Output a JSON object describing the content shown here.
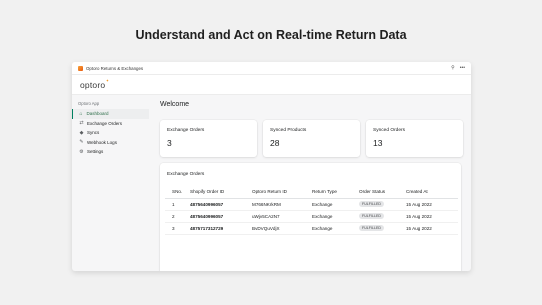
{
  "headline": "Understand and Act on Real-time Return Data",
  "window": {
    "title": "Optoro Returns & Exchanges",
    "pin_icon": "pin-icon",
    "more_icon": "more-icon"
  },
  "brand": {
    "logo_text": "optoro"
  },
  "sidebar": {
    "section_label": "Optoro App",
    "items": [
      {
        "label": "Dashboard",
        "icon": "home-icon",
        "active": true
      },
      {
        "label": "Exchange Orders",
        "icon": "exchange-icon"
      },
      {
        "label": "Syncs",
        "icon": "tag-icon"
      },
      {
        "label": "Webhook Logs",
        "icon": "wrench-icon"
      },
      {
        "label": "Settings",
        "icon": "gear-icon"
      }
    ]
  },
  "main": {
    "welcome": "Welcome",
    "stats": [
      {
        "label": "Exchange Orders",
        "value": "3"
      },
      {
        "label": "Synced Products",
        "value": "28"
      },
      {
        "label": "Synced Orders",
        "value": "13"
      }
    ],
    "table": {
      "title": "Exchange Orders",
      "columns": [
        "SNo.",
        "Shopify Order ID",
        "Optoro Return ID",
        "Return Type",
        "Order Status",
        "Created At"
      ],
      "rows": [
        [
          "1",
          "4875640996057",
          "M766NKrkRM",
          "Exchange",
          "FULFILLED",
          "15 Aug 2022"
        ],
        [
          "2",
          "4875640996057",
          "uWjv5CA2N7",
          "Exchange",
          "FULFILLED",
          "15 Aug 2022"
        ],
        [
          "3",
          "4875717312729",
          "BvDVQuVdjX",
          "Exchange",
          "FULFILLED",
          "15 Aug 2022"
        ]
      ]
    },
    "pager": {
      "prev": "‹",
      "next": "›"
    }
  },
  "colors": {
    "accent": "#008060",
    "brand_orange": "#f59a23"
  }
}
